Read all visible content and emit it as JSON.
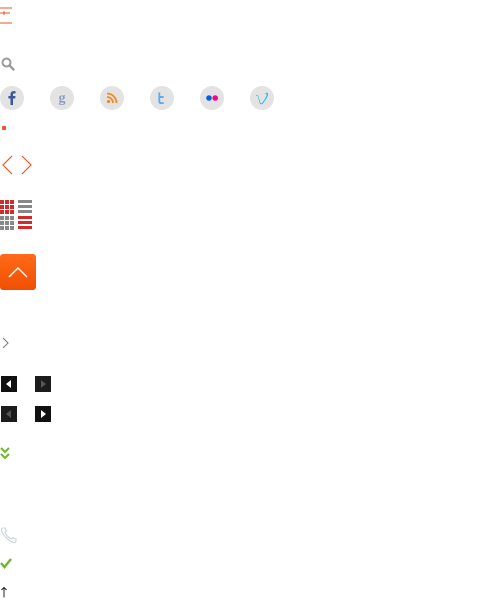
{
  "icons": {
    "menu": "menu-icon",
    "search": "search-icon",
    "social": [
      {
        "name": "facebook-icon",
        "glyph": "f",
        "color": "#3b5998"
      },
      {
        "name": "google-icon",
        "glyph": "g",
        "color": "#7a8fb8"
      },
      {
        "name": "rss-icon",
        "glyph": "",
        "color": "#f08a24"
      },
      {
        "name": "twitter-icon",
        "glyph": "t",
        "color": "#55acee"
      },
      {
        "name": "flickr-icon",
        "glyph": "",
        "color": "#0063dc"
      },
      {
        "name": "vimeo-icon",
        "glyph": "v",
        "color": "#1ab7ea"
      }
    ],
    "back_to_top": "chevron-up-icon",
    "phone": "phone-icon",
    "check": "check-icon",
    "up_arrow": "arrow-up-icon"
  },
  "colors": {
    "accent": "#e8562a",
    "orange_button": "#ff5a0a",
    "grid_red": "#d42a2a",
    "grid_gray": "#888888",
    "green": "#6cba2a",
    "dark_button": "#111111",
    "circle_bg": "#e3e3e3"
  }
}
